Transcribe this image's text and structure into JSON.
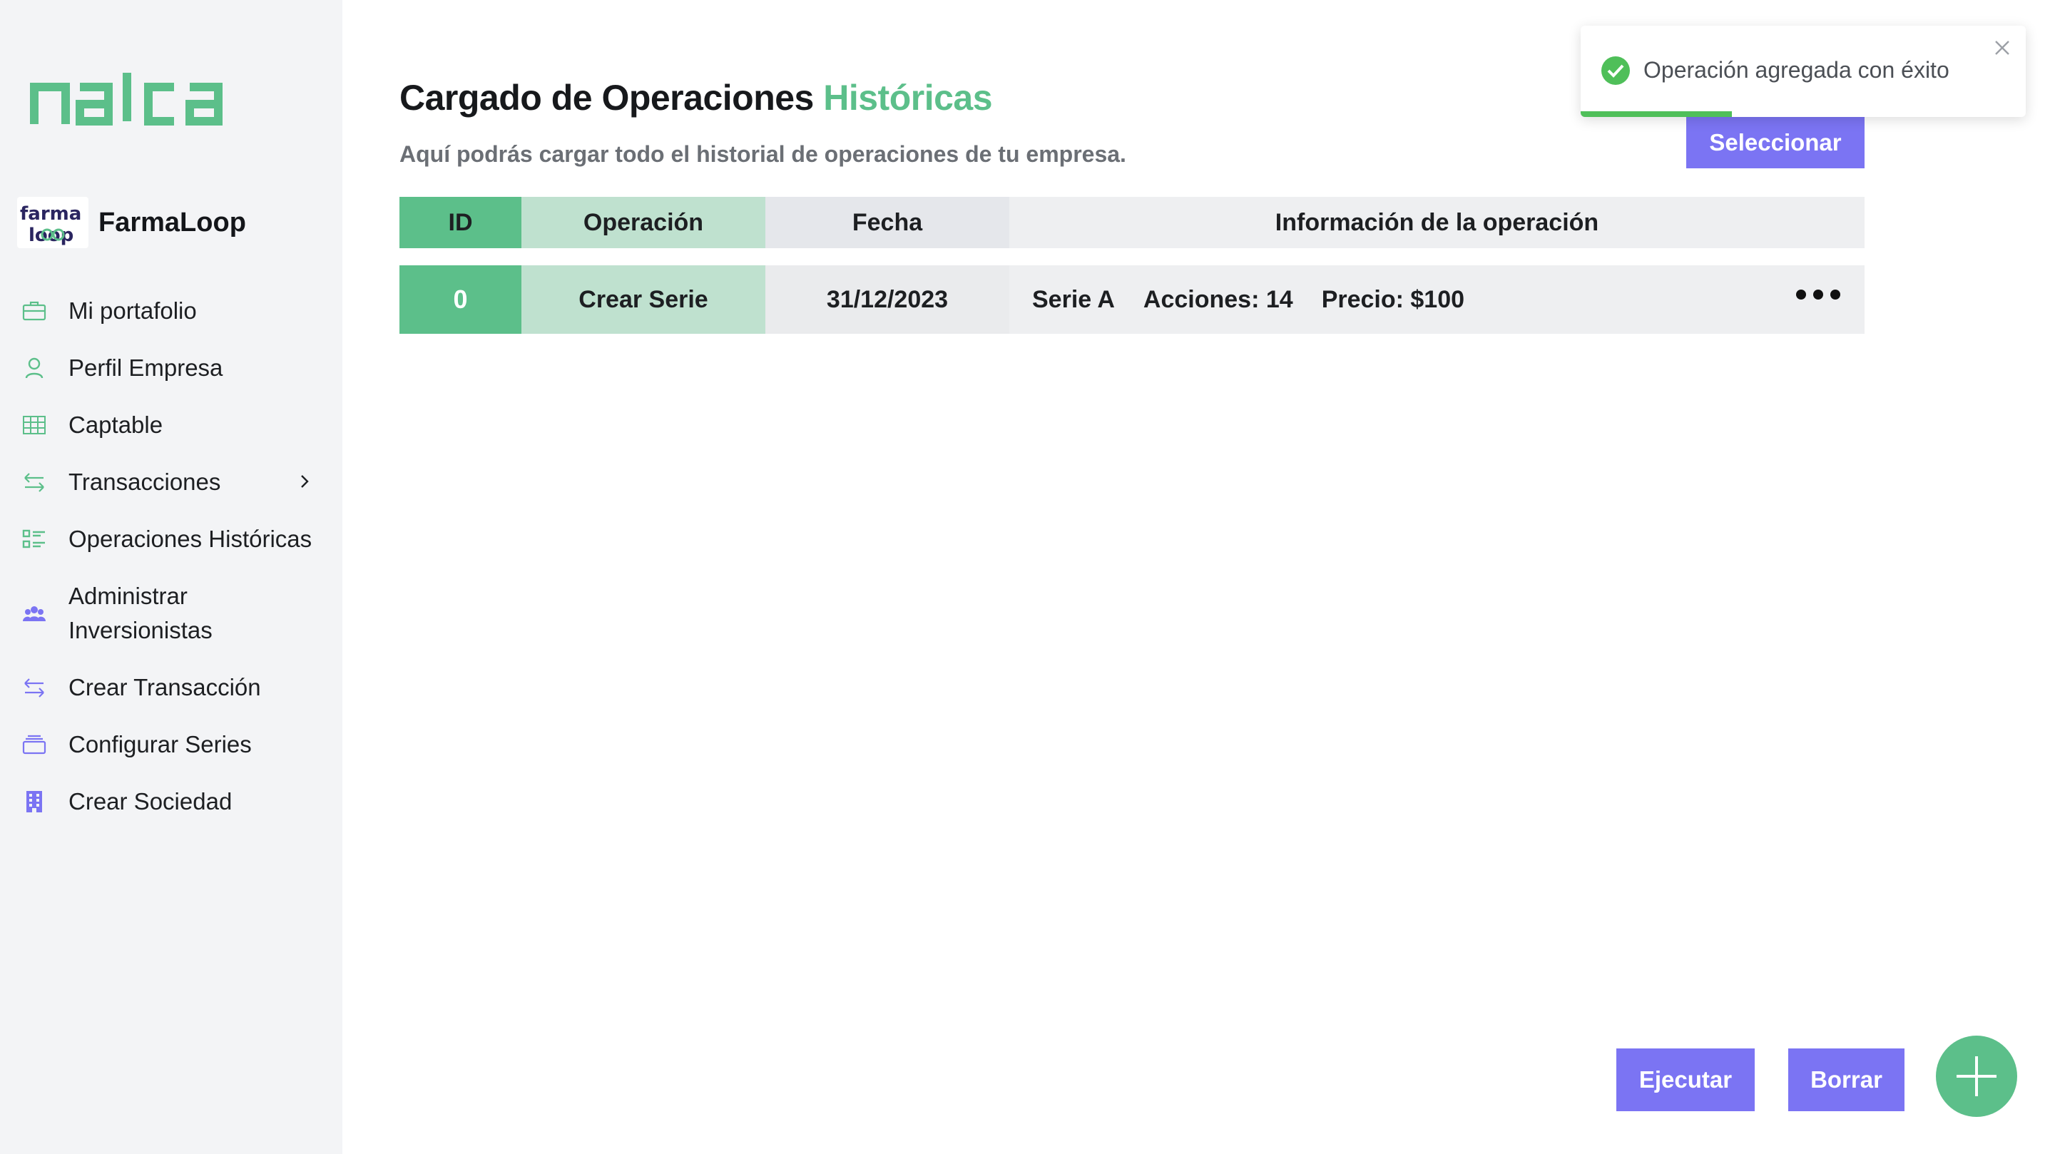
{
  "brand": {
    "logo_text": "nalca"
  },
  "company": {
    "name": "FarmaLoop",
    "logo_text_top": "farma",
    "logo_text_bottom": "loop"
  },
  "sidebar": {
    "items": [
      {
        "label": "Mi portafolio",
        "icon": "briefcase-icon"
      },
      {
        "label": "Perfil Empresa",
        "icon": "user-icon"
      },
      {
        "label": "Captable",
        "icon": "table-icon"
      },
      {
        "label": "Transacciones",
        "icon": "transfer-icon",
        "has_submenu": true
      },
      {
        "label": "Operaciones Históricas",
        "icon": "checklist-icon"
      },
      {
        "label": "Administrar\nInversionistas",
        "icon": "group-icon"
      },
      {
        "label": "Crear Transacción",
        "icon": "transfer-icon"
      },
      {
        "label": "Configurar Series",
        "icon": "stack-icon"
      },
      {
        "label": "Crear Sociedad",
        "icon": "building-icon"
      }
    ]
  },
  "header": {
    "title_main": "Cargado de Operaciones ",
    "title_accent": "Históricas",
    "subtitle": "Aquí podrás cargar todo el historial de operaciones de tu empresa.",
    "select_button": "Seleccionar"
  },
  "table": {
    "columns": [
      "ID",
      "Operación",
      "Fecha",
      "Información de la operación"
    ],
    "rows": [
      {
        "id": "0",
        "operation": "Crear Serie",
        "date": "31/12/2023",
        "info": [
          "Serie A",
          "Acciones: 14",
          "Precio: $100"
        ]
      }
    ]
  },
  "actions": {
    "run_button": "Ejecutar",
    "delete_button": "Borrar"
  },
  "toast": {
    "message": "Operación agregada con éxito",
    "progress": 0.34
  },
  "colors": {
    "accent_green": "#5cbf8a",
    "light_green": "#bfe1cf",
    "button_purple": "#7b74f3",
    "success_green": "#4fbf59",
    "sidebar_bg": "#f3f4f6"
  }
}
